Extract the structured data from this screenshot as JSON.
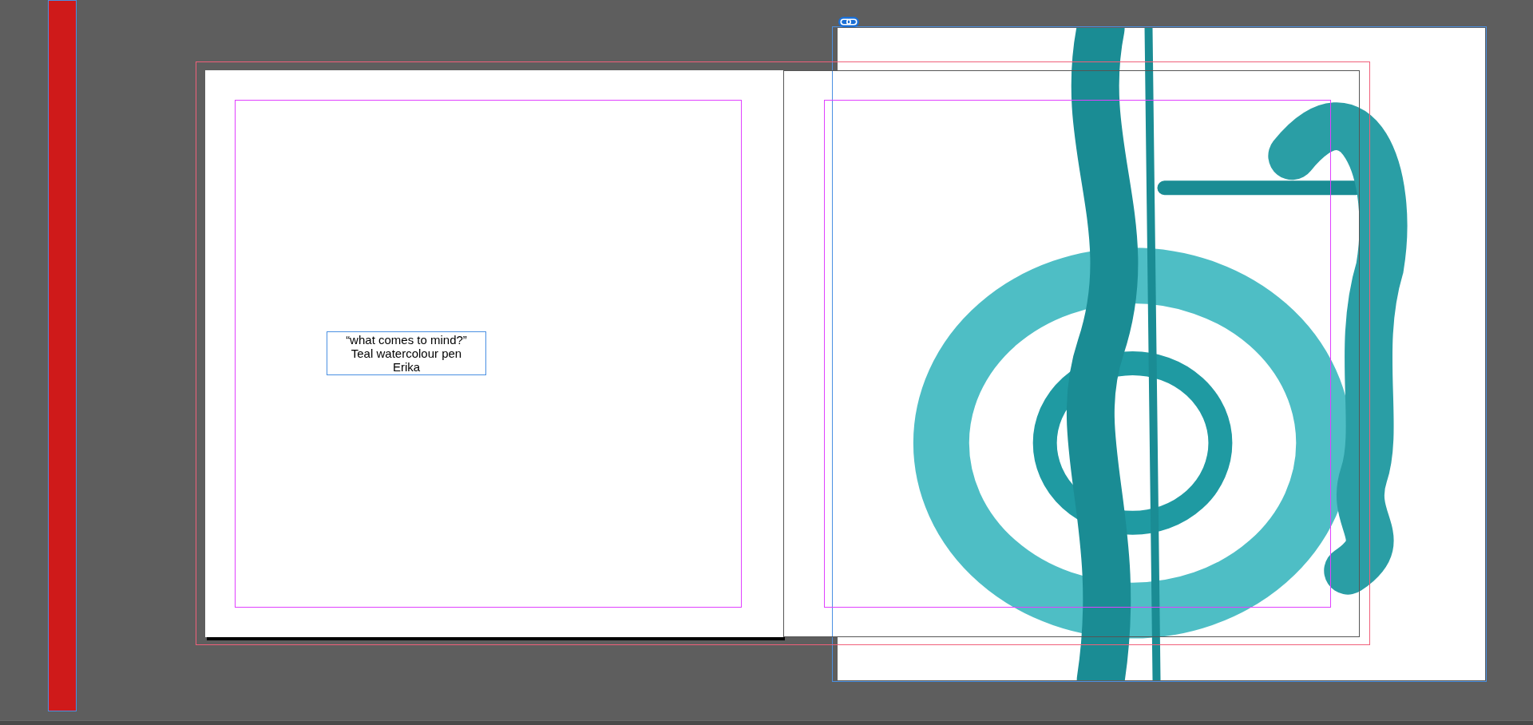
{
  "text_frame": {
    "lines": [
      "“what comes to mind?”",
      "Teal watercolour pen",
      "Erika"
    ]
  }
}
